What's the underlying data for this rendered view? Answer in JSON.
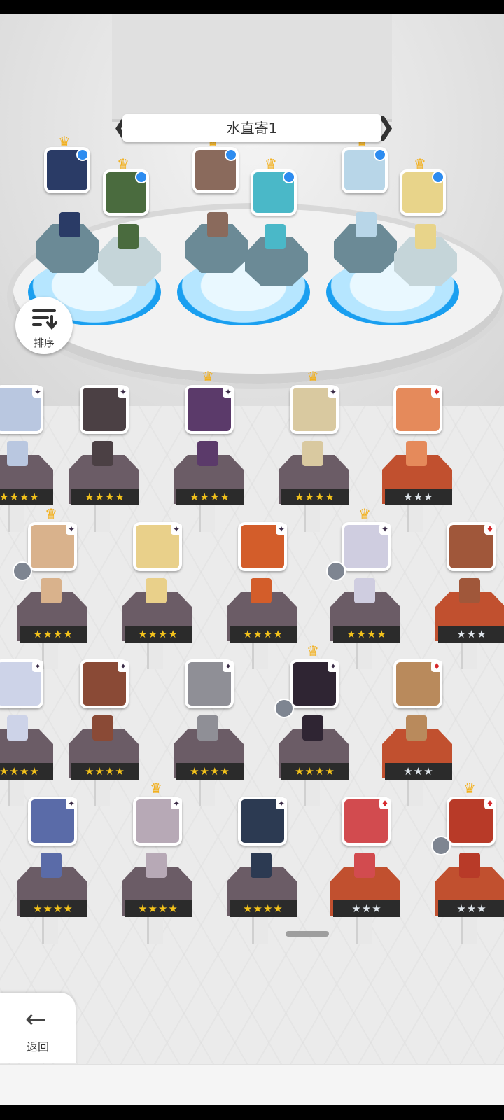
{
  "team": {
    "name": "水直寄1",
    "prev_icon": "chevron-left-icon",
    "next_icon": "chevron-right-icon"
  },
  "sort": {
    "label": "排序",
    "icon": "sort-icon"
  },
  "back": {
    "label": "返回",
    "icon": "arrow-left-icon"
  },
  "lineup": [
    {
      "face_color": "#2a3b66",
      "crowned": true
    },
    {
      "face_color": "#4a6b3e",
      "crowned": true
    },
    {
      "face_color": "#8a6a5c",
      "crowned": true
    },
    {
      "face_color": "#4ab8c8",
      "crowned": true
    },
    {
      "face_color": "#b8d6e8",
      "crowned": true
    },
    {
      "face_color": "#e8d48a",
      "crowned": true
    }
  ],
  "roster": [
    {
      "stars": "★★★★",
      "tier": "purple",
      "element": "dark",
      "crown": false,
      "face": "#b9c7e0"
    },
    {
      "stars": "★★★★",
      "tier": "purple",
      "element": "dark",
      "crown": false,
      "face": "#4b4044"
    },
    {
      "stars": "★★★★",
      "tier": "purple",
      "element": "dark",
      "crown": true,
      "face": "#5b3a6a"
    },
    {
      "stars": "★★★★",
      "tier": "purple",
      "element": "dark",
      "crown": true,
      "face": "#d9c9a0"
    },
    {
      "stars": "★★★",
      "tier": "orange",
      "element": "fire",
      "crown": false,
      "face": "#e58a5b"
    },
    {
      "stars": "★★★★",
      "tier": "purple",
      "element": "dark",
      "crown": true,
      "face": "#d9b28c"
    },
    {
      "stars": "★★★★",
      "tier": "purple",
      "element": "dark",
      "crown": false,
      "face": "#e9d08a"
    },
    {
      "stars": "★★★★",
      "tier": "purple",
      "element": "dark",
      "crown": false,
      "face": "#d35d2a"
    },
    {
      "stars": "★★★★",
      "tier": "purple",
      "element": "dark",
      "crown": true,
      "face": "#cfcde0"
    },
    {
      "stars": "★★★",
      "tier": "orange",
      "element": "fire",
      "crown": false,
      "face": "#a0573a"
    },
    {
      "stars": "★★★★",
      "tier": "purple",
      "element": "dark",
      "crown": false,
      "face": "#cdd3e8"
    },
    {
      "stars": "★★★★",
      "tier": "purple",
      "element": "dark",
      "crown": false,
      "face": "#8a4a36"
    },
    {
      "stars": "★★★★",
      "tier": "purple",
      "element": "dark",
      "crown": false,
      "face": "#8f8f96"
    },
    {
      "stars": "★★★★",
      "tier": "purple",
      "element": "dark",
      "crown": true,
      "face": "#2f2533"
    },
    {
      "stars": "★★★",
      "tier": "orange",
      "element": "fire",
      "crown": false,
      "face": "#b98a5c"
    },
    {
      "stars": "★★★★",
      "tier": "purple",
      "element": "dark",
      "crown": false,
      "face": "#5a6ba8"
    },
    {
      "stars": "★★★★",
      "tier": "purple",
      "element": "dark",
      "crown": true,
      "face": "#b7a9b6"
    },
    {
      "stars": "★★★★",
      "tier": "purple",
      "element": "dark",
      "crown": false,
      "face": "#2c3a52"
    },
    {
      "stars": "★★★",
      "tier": "orange",
      "element": "fire",
      "crown": false,
      "face": "#d24b4f"
    },
    {
      "stars": "★★★",
      "tier": "orange",
      "element": "fire",
      "crown": true,
      "face": "#b83a28"
    }
  ]
}
